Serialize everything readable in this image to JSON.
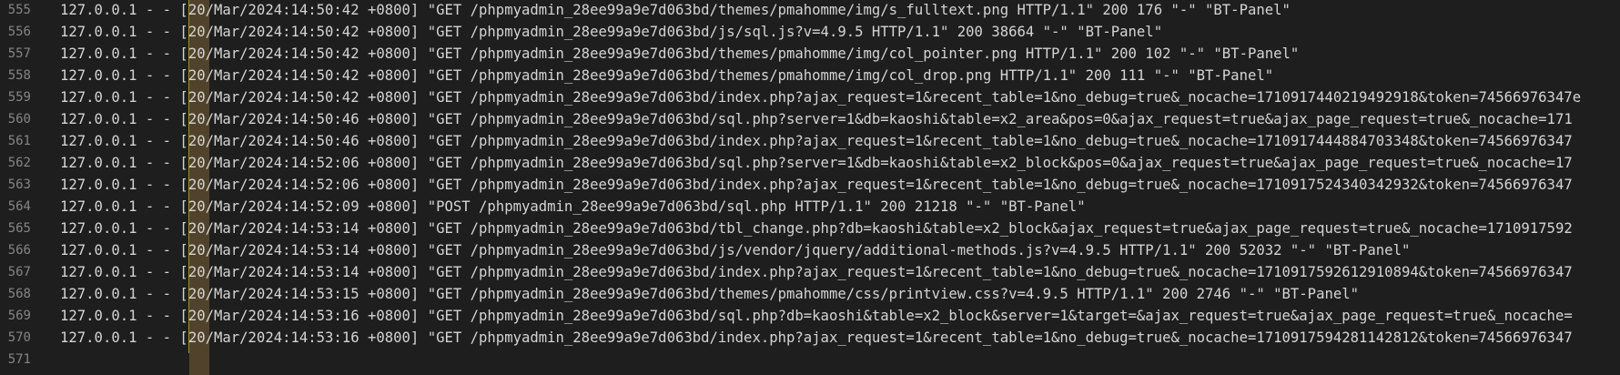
{
  "lines": [
    {
      "num": "555",
      "text": "127.0.0.1 - - [20/Mar/2024:14:50:42 +0800] \"GET /phpmyadmin_28ee99a9e7d063bd/themes/pmahomme/img/s_fulltext.png HTTP/1.1\" 200 176 \"-\" \"BT-Panel\""
    },
    {
      "num": "556",
      "text": "127.0.0.1 - - [20/Mar/2024:14:50:42 +0800] \"GET /phpmyadmin_28ee99a9e7d063bd/js/sql.js?v=4.9.5 HTTP/1.1\" 200 38664 \"-\" \"BT-Panel\""
    },
    {
      "num": "557",
      "text": "127.0.0.1 - - [20/Mar/2024:14:50:42 +0800] \"GET /phpmyadmin_28ee99a9e7d063bd/themes/pmahomme/img/col_pointer.png HTTP/1.1\" 200 102 \"-\" \"BT-Panel\""
    },
    {
      "num": "558",
      "text": "127.0.0.1 - - [20/Mar/2024:14:50:42 +0800] \"GET /phpmyadmin_28ee99a9e7d063bd/themes/pmahomme/img/col_drop.png HTTP/1.1\" 200 111 \"-\" \"BT-Panel\""
    },
    {
      "num": "559",
      "text": "127.0.0.1 - - [20/Mar/2024:14:50:42 +0800] \"GET /phpmyadmin_28ee99a9e7d063bd/index.php?ajax_request=1&recent_table=1&no_debug=true&_nocache=1710917440219492918&token=74566976347e"
    },
    {
      "num": "560",
      "text": "127.0.0.1 - - [20/Mar/2024:14:50:46 +0800] \"GET /phpmyadmin_28ee99a9e7d063bd/sql.php?server=1&db=kaoshi&table=x2_area&pos=0&ajax_request=true&ajax_page_request=true&_nocache=171"
    },
    {
      "num": "561",
      "text": "127.0.0.1 - - [20/Mar/2024:14:50:46 +0800] \"GET /phpmyadmin_28ee99a9e7d063bd/index.php?ajax_request=1&recent_table=1&no_debug=true&_nocache=1710917444884703348&token=74566976347"
    },
    {
      "num": "562",
      "text": "127.0.0.1 - - [20/Mar/2024:14:52:06 +0800] \"GET /phpmyadmin_28ee99a9e7d063bd/sql.php?server=1&db=kaoshi&table=x2_block&pos=0&ajax_request=true&ajax_page_request=true&_nocache=17"
    },
    {
      "num": "563",
      "text": "127.0.0.1 - - [20/Mar/2024:14:52:06 +0800] \"GET /phpmyadmin_28ee99a9e7d063bd/index.php?ajax_request=1&recent_table=1&no_debug=true&_nocache=1710917524340342932&token=74566976347"
    },
    {
      "num": "564",
      "text": "127.0.0.1 - - [20/Mar/2024:14:52:09 +0800] \"POST /phpmyadmin_28ee99a9e7d063bd/sql.php HTTP/1.1\" 200 21218 \"-\" \"BT-Panel\""
    },
    {
      "num": "565",
      "text": "127.0.0.1 - - [20/Mar/2024:14:53:14 +0800] \"GET /phpmyadmin_28ee99a9e7d063bd/tbl_change.php?db=kaoshi&table=x2_block&ajax_request=true&ajax_page_request=true&_nocache=1710917592"
    },
    {
      "num": "566",
      "text": "127.0.0.1 - - [20/Mar/2024:14:53:14 +0800] \"GET /phpmyadmin_28ee99a9e7d063bd/js/vendor/jquery/additional-methods.js?v=4.9.5 HTTP/1.1\" 200 52032 \"-\" \"BT-Panel\""
    },
    {
      "num": "567",
      "text": "127.0.0.1 - - [20/Mar/2024:14:53:14 +0800] \"GET /phpmyadmin_28ee99a9e7d063bd/index.php?ajax_request=1&recent_table=1&no_debug=true&_nocache=1710917592612910894&token=74566976347"
    },
    {
      "num": "568",
      "text": "127.0.0.1 - - [20/Mar/2024:14:53:15 +0800] \"GET /phpmyadmin_28ee99a9e7d063bd/themes/pmahomme/css/printview.css?v=4.9.5 HTTP/1.1\" 200 2746 \"-\" \"BT-Panel\""
    },
    {
      "num": "569",
      "text": "127.0.0.1 - - [20/Mar/2024:14:53:16 +0800] \"GET /phpmyadmin_28ee99a9e7d063bd/sql.php?db=kaoshi&table=x2_block&server=1&target=&ajax_request=true&ajax_page_request=true&_nocache="
    },
    {
      "num": "570",
      "text": "127.0.0.1 - - [20/Mar/2024:14:53:16 +0800] \"GET /phpmyadmin_28ee99a9e7d063bd/index.php?ajax_request=1&recent_table=1&no_debug=true&_nocache=1710917594281142812&token=74566976347"
    },
    {
      "num": "571",
      "text": ""
    }
  ],
  "colors": {
    "background": "#1e1e1e",
    "text": "#d4d4d4",
    "line_number": "#858585",
    "column_highlight": "#5a4a2e"
  }
}
